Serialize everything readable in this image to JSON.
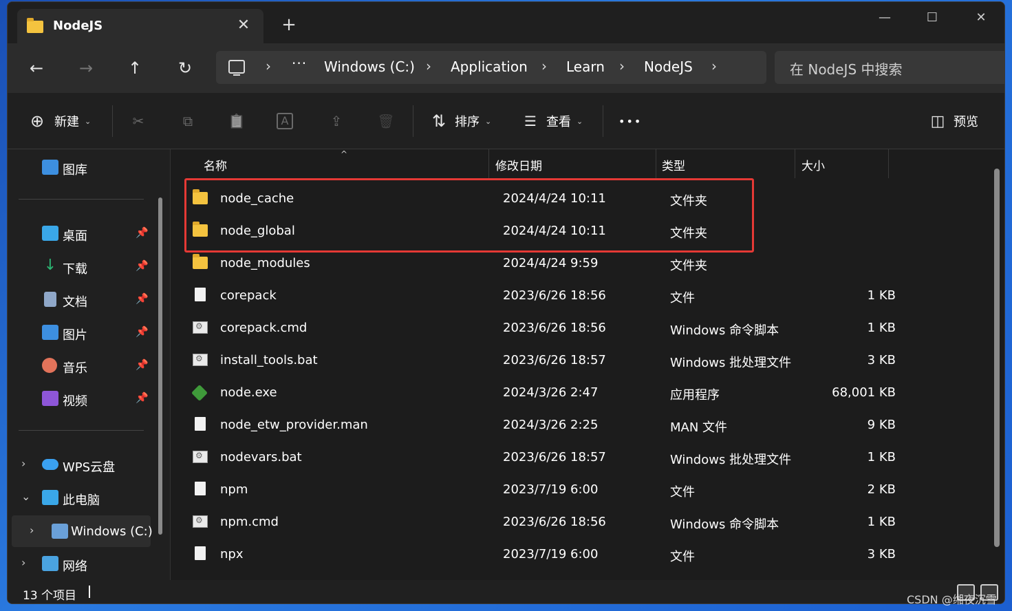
{
  "window": {
    "tab_title": "NodeJS",
    "close_tab": "✕",
    "new_tab": "+",
    "minimize": "—",
    "maximize": "☐",
    "close": "✕"
  },
  "nav": {
    "back": "←",
    "forward": "→",
    "up": "↑",
    "refresh": "↻",
    "more_crumbs": "···",
    "breadcrumbs": [
      "Windows (C:)",
      "Application",
      "Learn",
      "NodeJS"
    ],
    "chevron": "›",
    "search_placeholder": "在 NodeJS 中搜索"
  },
  "toolbar": {
    "new_label": "新建",
    "new_icon": "⊕",
    "cut_icon": "✂",
    "copy_icon": "⧉",
    "paste_icon": "📋",
    "rename_icon": "A",
    "share_icon": "⇪",
    "delete_icon": "🗑",
    "sort_label": "排序",
    "sort_icon": "⇅",
    "view_label": "查看",
    "view_icon": "☰",
    "more_label": "•••",
    "preview_label": "预览",
    "preview_icon": "◫",
    "caret": "⌄"
  },
  "sidebar": {
    "gallery": "图库",
    "quick_access": [
      {
        "label": "桌面",
        "color": "#3aa7e8"
      },
      {
        "label": "下载",
        "color": "#2cb673"
      },
      {
        "label": "文档",
        "color": "#8fa7c8"
      },
      {
        "label": "图片",
        "color": "#3d8fe0"
      },
      {
        "label": "音乐",
        "color": "#e2735a"
      },
      {
        "label": "视频",
        "color": "#8e56d8"
      }
    ],
    "pin": "📌",
    "wps": "WPS云盘",
    "this_pc": "此电脑",
    "drive_c": "Windows (C:)",
    "network": "网络",
    "expand_closed": "›",
    "expand_open": "⌄"
  },
  "columns": {
    "name": "名称",
    "modified": "修改日期",
    "type": "类型",
    "size": "大小",
    "sort_arrow": "^"
  },
  "files": [
    {
      "name": "node_cache",
      "date": "2024/4/24 10:11",
      "type": "文件夹",
      "size": "",
      "icon": "folder"
    },
    {
      "name": "node_global",
      "date": "2024/4/24 10:11",
      "type": "文件夹",
      "size": "",
      "icon": "folder"
    },
    {
      "name": "node_modules",
      "date": "2024/4/24 9:59",
      "type": "文件夹",
      "size": "",
      "icon": "folder"
    },
    {
      "name": "corepack",
      "date": "2023/6/26 18:56",
      "type": "文件",
      "size": "1 KB",
      "icon": "file"
    },
    {
      "name": "corepack.cmd",
      "date": "2023/6/26 18:56",
      "type": "Windows 命令脚本",
      "size": "1 KB",
      "icon": "script"
    },
    {
      "name": "install_tools.bat",
      "date": "2023/6/26 18:57",
      "type": "Windows 批处理文件",
      "size": "3 KB",
      "icon": "script"
    },
    {
      "name": "node.exe",
      "date": "2024/3/26 2:47",
      "type": "应用程序",
      "size": "68,001 KB",
      "icon": "exe"
    },
    {
      "name": "node_etw_provider.man",
      "date": "2024/3/26 2:25",
      "type": "MAN 文件",
      "size": "9 KB",
      "icon": "file"
    },
    {
      "name": "nodevars.bat",
      "date": "2023/6/26 18:57",
      "type": "Windows 批处理文件",
      "size": "1 KB",
      "icon": "script"
    },
    {
      "name": "npm",
      "date": "2023/7/19 6:00",
      "type": "文件",
      "size": "2 KB",
      "icon": "file"
    },
    {
      "name": "npm.cmd",
      "date": "2023/6/26 18:56",
      "type": "Windows 命令脚本",
      "size": "1 KB",
      "icon": "script"
    },
    {
      "name": "npx",
      "date": "2023/7/19 6:00",
      "type": "文件",
      "size": "3 KB",
      "icon": "file"
    }
  ],
  "status": {
    "item_count": "13 个项目"
  },
  "watermark": "CSDN @缃夜沉雪"
}
